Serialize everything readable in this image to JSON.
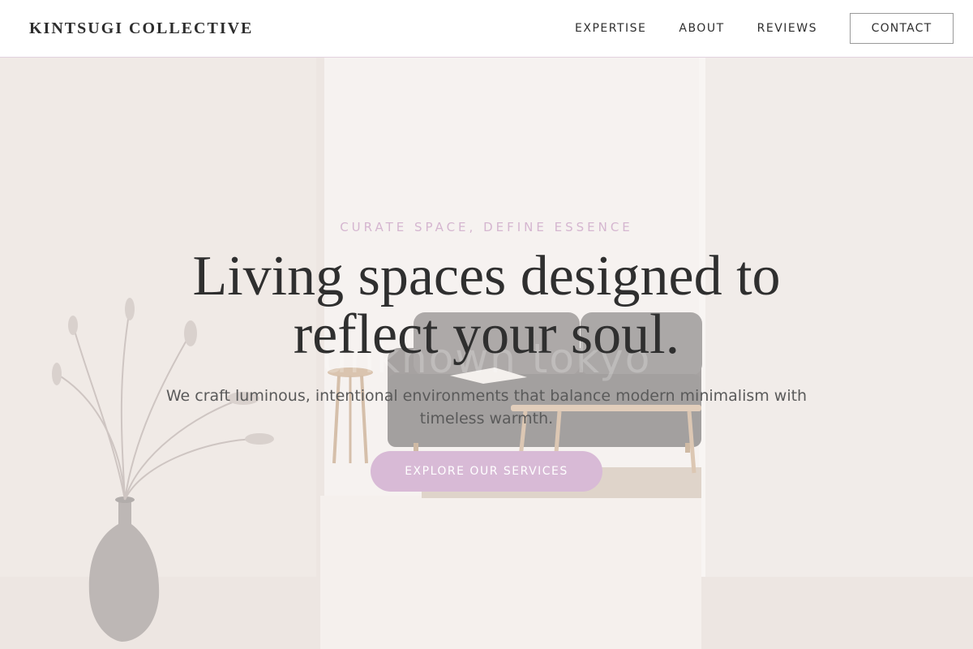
{
  "header": {
    "brand": "KINTSUGI COLLECTIVE",
    "nav": [
      {
        "label": "EXPERTISE"
      },
      {
        "label": "ABOUT"
      },
      {
        "label": "REVIEWS"
      }
    ],
    "contact_label": "CONTACT"
  },
  "hero": {
    "watermark": "unknown tokyo",
    "eyebrow": "CURATE SPACE, DEFINE ESSENCE",
    "headline": "Living spaces designed to reflect your soul.",
    "subtitle": "We craft luminous, intentional environments that balance modern minimalism with timeless warmth.",
    "cta_label": "EXPLORE OUR SERVICES"
  },
  "colors": {
    "accent": "#d8bad6",
    "eyebrow": "#d5b6d0",
    "text_dark": "#2f2f2f",
    "text_muted": "#5a5a5a",
    "header_border": "#e2d2de"
  },
  "icons": {
    "hero_image": "living-room-photo"
  }
}
